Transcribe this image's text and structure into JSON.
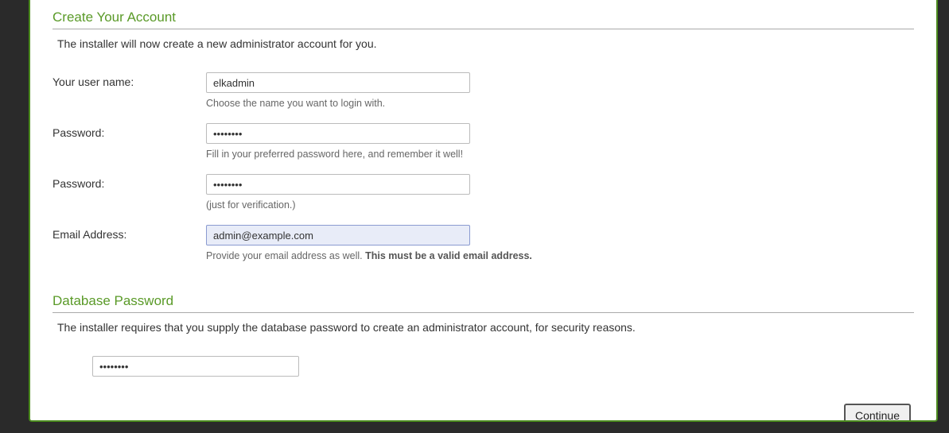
{
  "account_section": {
    "title": "Create Your Account",
    "description": "The installer will now create a new administrator account for you.",
    "fields": {
      "username": {
        "label": "Your user name:",
        "value": "elkadmin",
        "hint": "Choose the name you want to login with."
      },
      "password1": {
        "label": "Password:",
        "value": "••••••••",
        "hint": "Fill in your preferred password here, and remember it well!"
      },
      "password2": {
        "label": "Password:",
        "value": "••••••••",
        "hint": "(just for verification.)"
      },
      "email": {
        "label": "Email Address:",
        "value": "admin@example.com",
        "hint_prefix": "Provide your email address as well. ",
        "hint_strong": "This must be a valid email address."
      }
    }
  },
  "db_section": {
    "title": "Database Password",
    "description": "The installer requires that you supply the database password to create an administrator account, for security reasons.",
    "value": "••••••••"
  },
  "buttons": {
    "continue": "Continue"
  }
}
